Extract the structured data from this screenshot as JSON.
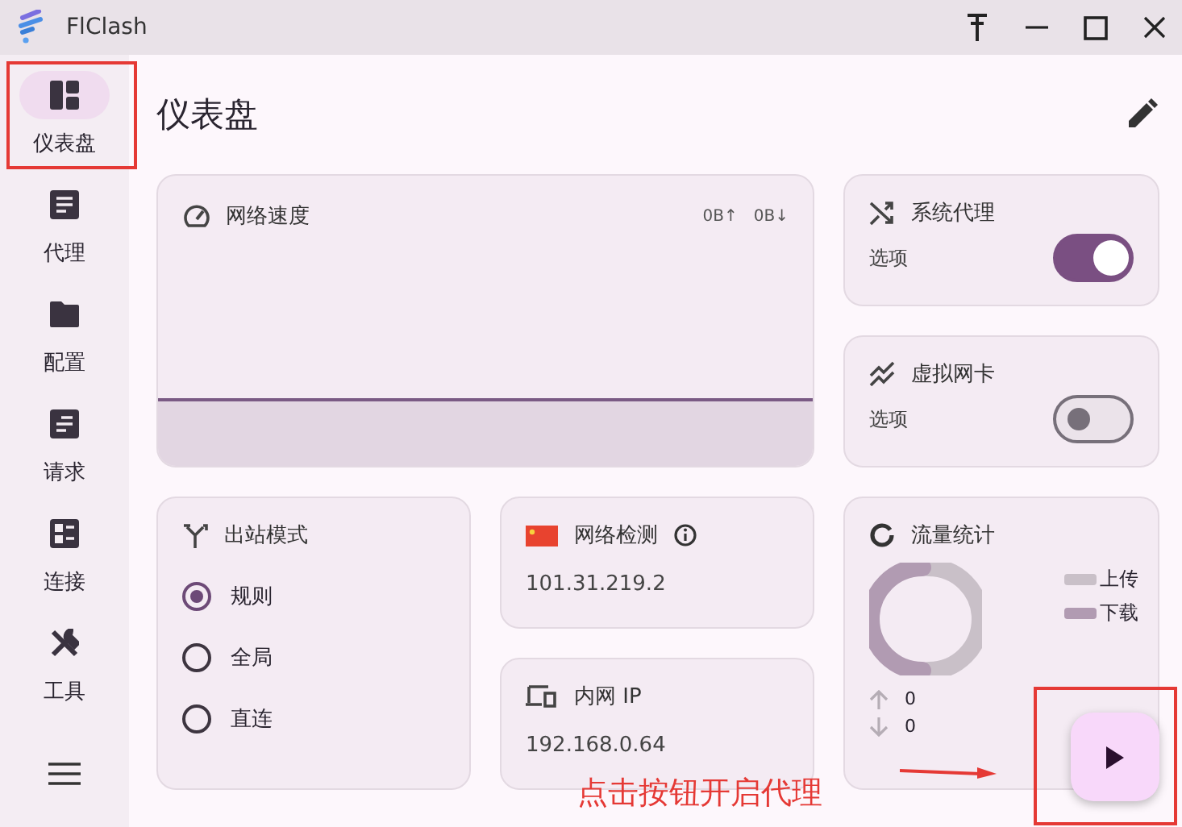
{
  "window": {
    "title": "FlClash"
  },
  "sidebar": {
    "items": [
      {
        "label": "仪表盘",
        "selected": true
      },
      {
        "label": "代理",
        "selected": false
      },
      {
        "label": "配置",
        "selected": false
      },
      {
        "label": "请求",
        "selected": false
      },
      {
        "label": "连接",
        "selected": false
      },
      {
        "label": "工具",
        "selected": false
      }
    ]
  },
  "page_title": "仪表盘",
  "network_speed": {
    "title": "网络速度",
    "upload": "0B↑",
    "download": "0B↓"
  },
  "system_proxy": {
    "title": "系统代理",
    "option_label": "选项",
    "on": true
  },
  "virtual_nic": {
    "title": "虚拟网卡",
    "option_label": "选项",
    "on": false
  },
  "outbound_mode": {
    "title": "出站模式",
    "options": [
      {
        "label": "规则",
        "selected": true
      },
      {
        "label": "全局",
        "selected": false
      },
      {
        "label": "直连",
        "selected": false
      }
    ]
  },
  "network_check": {
    "title": "网络检测",
    "value": "101.31.219.2"
  },
  "intranet_ip": {
    "title": "内网 IP",
    "value": "192.168.0.64"
  },
  "traffic": {
    "title": "流量统计",
    "legend": [
      "上传",
      "下载"
    ],
    "upload": "0",
    "download": "0"
  },
  "annotation": {
    "text": "点击按钮开启代理"
  }
}
